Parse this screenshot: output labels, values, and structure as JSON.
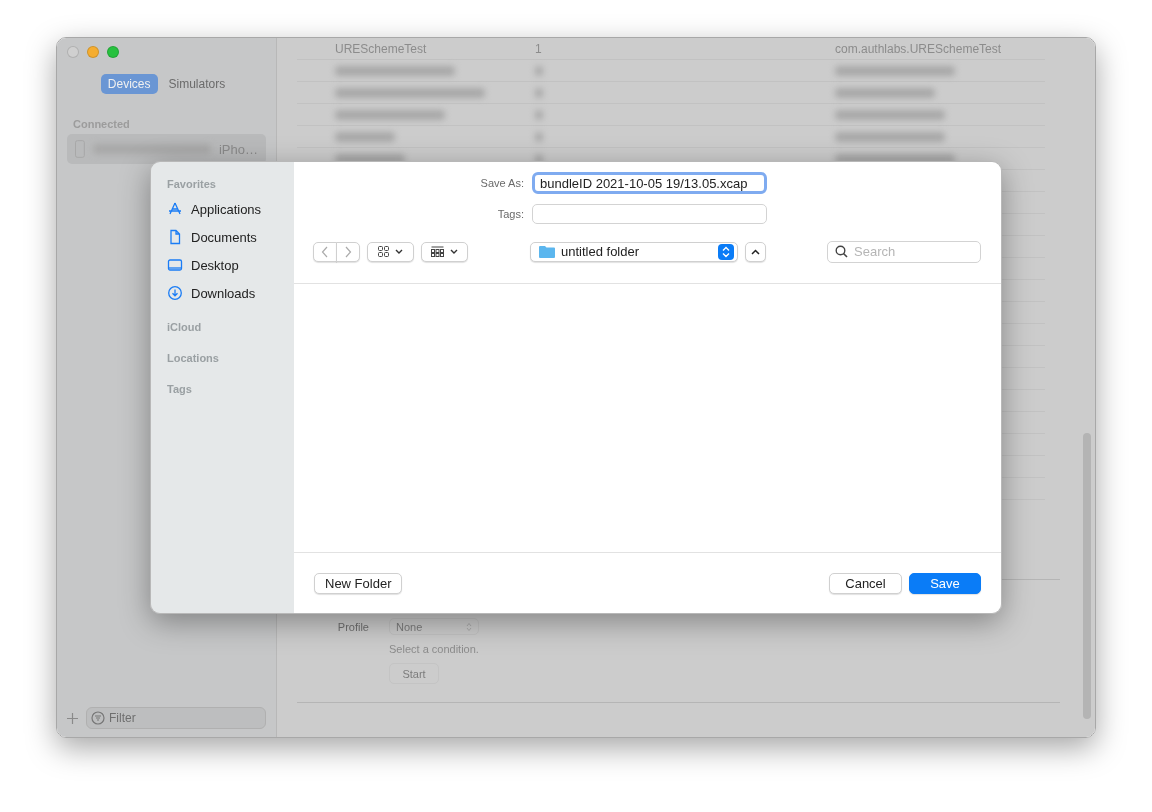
{
  "window": {
    "sidebar": {
      "tabs": [
        {
          "label": "Devices",
          "selected": true
        },
        {
          "label": "Simulators",
          "selected": false
        }
      ],
      "section": "Connected",
      "devices": [
        {
          "name": "iPho…",
          "selected": true
        }
      ],
      "filter": {
        "placeholder": "Filter"
      }
    },
    "list": {
      "top_row": {
        "name": "URESchemeTest",
        "column_2": "1",
        "column_3": "com.authlabs.URESchemeTest"
      }
    },
    "condition": {
      "label": "Profile",
      "value": "None",
      "hint": "Select a condition.",
      "button": "Start"
    }
  },
  "dialog": {
    "sidebar": [
      {
        "title": "Favorites",
        "items": [
          {
            "label": "Applications",
            "kind": "apps"
          },
          {
            "label": "Documents",
            "kind": "document"
          },
          {
            "label": "Desktop",
            "kind": "desktop"
          },
          {
            "label": "Downloads",
            "kind": "download"
          }
        ]
      },
      {
        "title": "iCloud"
      },
      {
        "title": "Locations"
      },
      {
        "title": "Tags"
      }
    ],
    "save_as": {
      "label": "Save As:",
      "value": "bundleID 2021-10-05 19/13.05.xcap"
    },
    "tags": {
      "label": "Tags:"
    },
    "location": "untitled folder",
    "search": {
      "placeholder": "Search"
    },
    "buttons": {
      "new_folder": "New Folder",
      "cancel": "Cancel",
      "save": "Save"
    }
  }
}
